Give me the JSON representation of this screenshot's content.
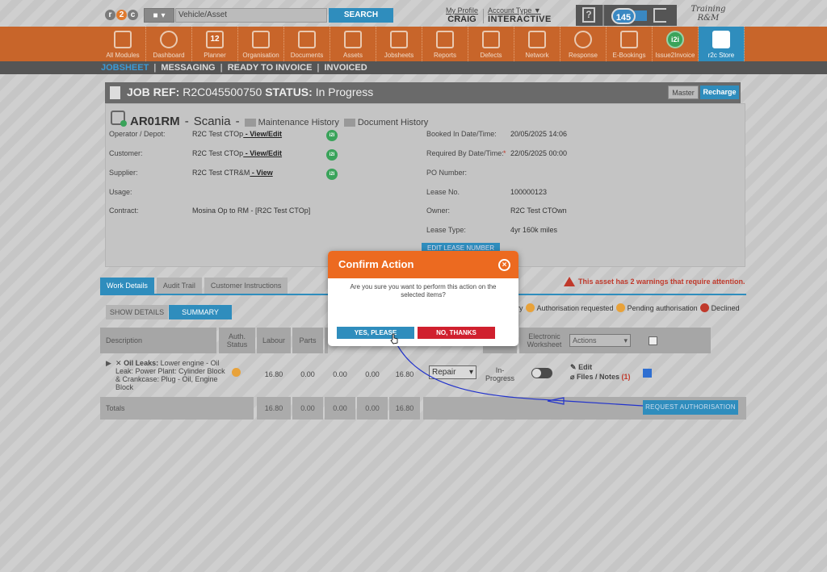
{
  "header": {
    "logo_letters": [
      "r",
      "2",
      "c"
    ],
    "search_placeholder": "Vehicle/Asset",
    "search_button": "SEARCH",
    "profile_link": "My Profile",
    "profile_name": "CRAIG",
    "account_type_link": "Account Type",
    "account_type_value": "INTERACTIVE",
    "help_icon_label": "?",
    "messages_badge": "145",
    "training_line1": "Training",
    "training_line2": "R&M"
  },
  "modules": [
    {
      "label": "All Modules",
      "icon": "grid-icon"
    },
    {
      "label": "Dashboard",
      "icon": "gauge-icon"
    },
    {
      "label": "Planner",
      "icon": "calendar-icon",
      "glyph": "12"
    },
    {
      "label": "Organisation",
      "icon": "building-icon"
    },
    {
      "label": "Documents",
      "icon": "folder-icon"
    },
    {
      "label": "Assets",
      "icon": "truck-icon"
    },
    {
      "label": "Jobsheets",
      "icon": "tools-icon"
    },
    {
      "label": "Reports",
      "icon": "report-icon"
    },
    {
      "label": "Defects",
      "icon": "warning-icon"
    },
    {
      "label": "Network",
      "icon": "contacts-icon"
    },
    {
      "label": "Response",
      "icon": "lifebuoy-icon"
    },
    {
      "label": "E-Bookings",
      "icon": "laptop-icon"
    },
    {
      "label": "Issue2Invoice",
      "icon": "i2i-icon",
      "glyph": "i2i"
    },
    {
      "label": "r2c Store",
      "icon": "briefcase-icon"
    }
  ],
  "subnav": {
    "jobsheet": "JOBSHEET",
    "messaging": "MESSAGING",
    "ready": "READY TO INVOICE",
    "invoiced": "INVOICED",
    "pipe": "|"
  },
  "job": {
    "ref_label": "JOB REF:",
    "ref_value": "R2C045500750",
    "status_label": "STATUS:",
    "status_value": "In Progress",
    "master_button": "Master",
    "recharge_button": "Recharge",
    "reg": "AR01RM",
    "dash": "-",
    "make": "Scania",
    "maintenance_history": "Maintenance History",
    "document_history": "Document History",
    "i2i_badge": "i2i"
  },
  "details_left": [
    {
      "label": "Operator / Depot:",
      "value": "R2C Test CTOp",
      "link": " - View/Edit",
      "badge": true
    },
    {
      "label": "Customer:",
      "value": "R2C Test CTOp",
      "link": " - View/Edit",
      "badge": true
    },
    {
      "label": "Supplier:",
      "value": "R2C Test CTR&M",
      "link": " - View",
      "badge": true
    },
    {
      "label": "Usage:",
      "value": "",
      "link": "",
      "badge": false
    },
    {
      "label": "Contract:",
      "value": "Mosina Op to RM - [R2C Test CTOp]",
      "link": "",
      "badge": false
    }
  ],
  "details_right": [
    {
      "label": "Booked In Date/Time:",
      "value": "20/05/2025 14:06",
      "required": false
    },
    {
      "label": "Required By Date/Time:",
      "value": "22/05/2025 00:00",
      "required": true
    },
    {
      "label": "PO Number:",
      "value": "",
      "required": false
    },
    {
      "label": "Lease No.",
      "value": "100000123",
      "required": false
    },
    {
      "label": "Owner:",
      "value": "R2C Test CTOwn",
      "required": false
    },
    {
      "label": "Lease Type:",
      "value": "4yr 160k miles",
      "required": false
    }
  ],
  "required_mark": "*",
  "edit_lease_button": "EDIT LEASE NUMBER",
  "tabs": [
    "Work Details",
    "Audit Trail",
    "Customer Instructions"
  ],
  "warning_text": "This asset has 2 warnings that require attention.",
  "view_toggle": {
    "show_details": "SHOW DETAILS",
    "summary": "SUMMARY"
  },
  "legend": {
    "history_suffix": "ry",
    "auth_requested": "Authorisation requested",
    "pending": "Pending authorisation",
    "declined": "Declined"
  },
  "table": {
    "headers": {
      "description": "Description",
      "auth_status": "Auth. Status",
      "labour": "Labour",
      "parts": "Parts",
      "electronic_worksheet": "Electronic Worksheet",
      "actions": "Actions"
    },
    "row": {
      "desc_bold": "Oil Leaks:",
      "desc_rest": " Lower engine - Oil Leak: Power Plant: Cylinder Block & Crankcase: Plug - Oil, Engine Block",
      "labour": "16.80",
      "parts": "0.00",
      "c3": "0.00",
      "c4": "0.00",
      "total": "16.80",
      "work_type": "Repair",
      "status": "In-Progress",
      "edit": "Edit",
      "files": "Files / Notes",
      "files_count": "(1)"
    },
    "totals": {
      "label": "Totals",
      "labour": "16.80",
      "parts": "0.00",
      "c3": "0.00",
      "c4": "0.00",
      "total": "16.80"
    },
    "request_auth_button": "REQUEST AUTHORISATION"
  },
  "modal": {
    "title": "Confirm Action",
    "message": "Are you sure you want to perform this action on the selected items?",
    "yes": "YES, PLEASE",
    "no": "NO, THANKS",
    "close_glyph": "×"
  },
  "colors": {
    "orange": "#c8652a",
    "blue": "#2f8dbd",
    "modal_orange": "#ec6a20",
    "red": "#d0202e",
    "green": "#3aa35a"
  }
}
